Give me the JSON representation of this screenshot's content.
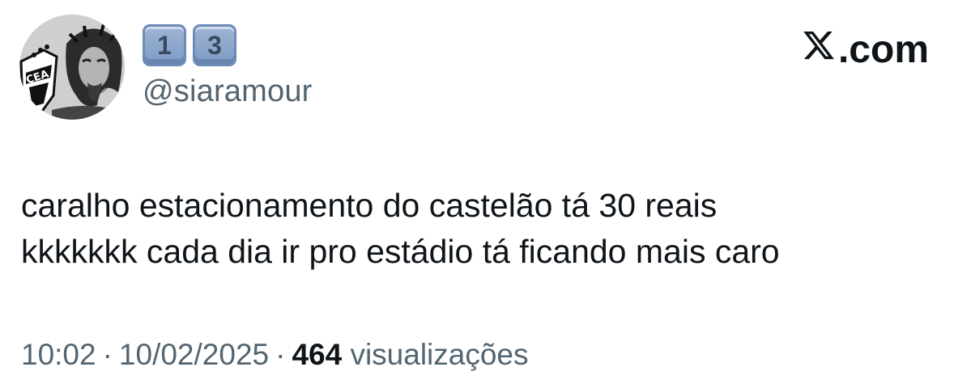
{
  "user": {
    "avatar_icon": "profile-photo-crest-with-portrait",
    "avatar_text": "CEA",
    "display_name_keycaps": [
      "1",
      "3"
    ],
    "handle": "@siaramour"
  },
  "brand": {
    "logo_icon": "x-logo-icon",
    "logo_suffix": ".com"
  },
  "tweet": {
    "lines": [
      "caralho estacionamento do castelão tá 30 reais",
      "kkkkkkk cada dia ir pro estádio tá ficando mais caro"
    ]
  },
  "meta": {
    "time": "10:02",
    "separator": "·",
    "date": "10/02/2025",
    "views_count": "464",
    "views_label": "visualizações"
  },
  "colors": {
    "text": "#0f1419",
    "secondary": "#536471",
    "keycap": "#8aa5cb"
  }
}
